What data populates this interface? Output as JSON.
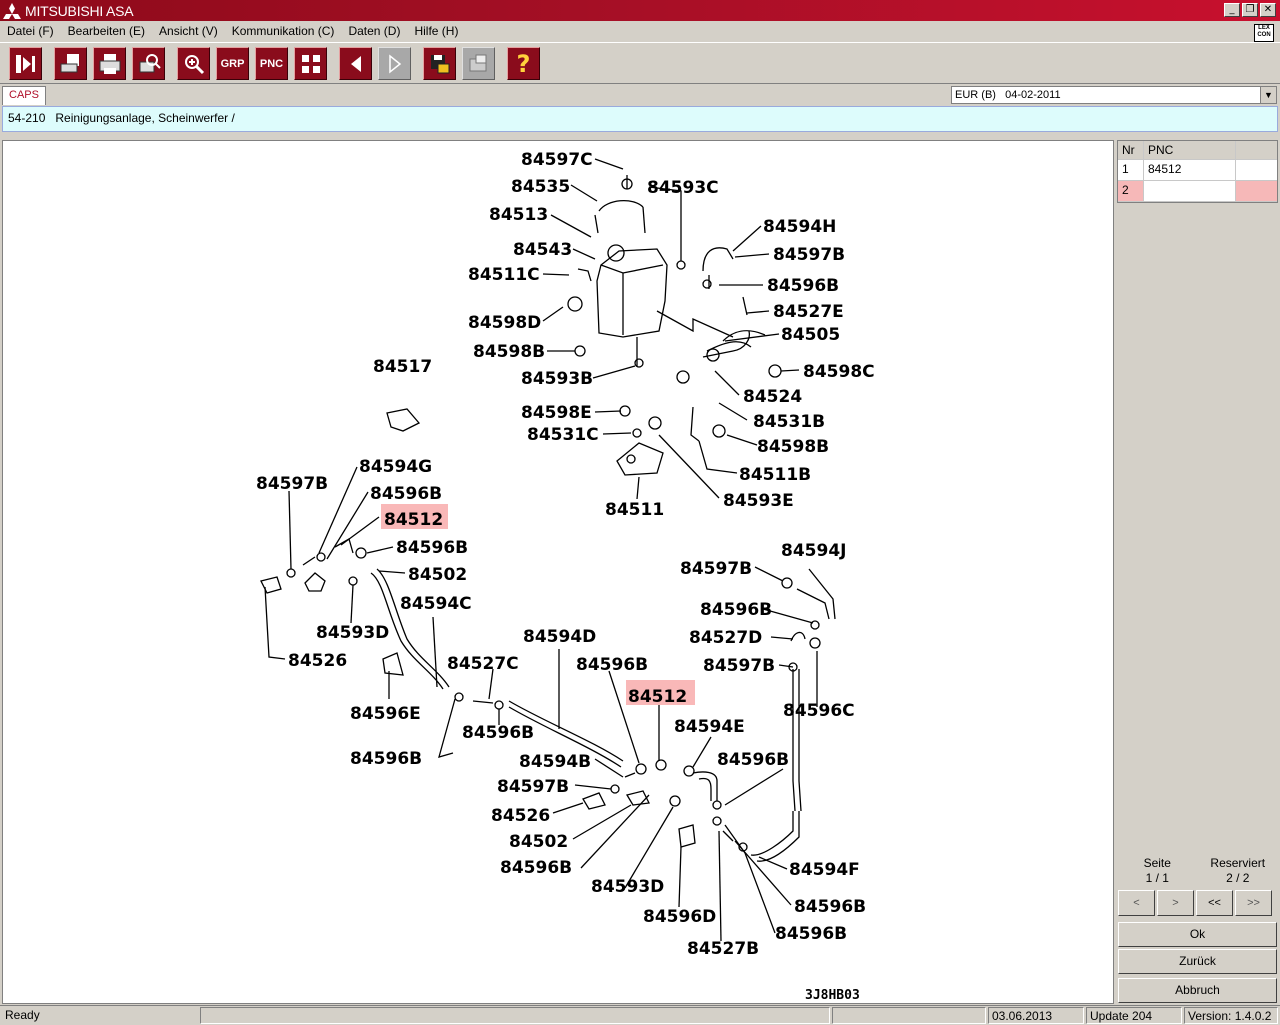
{
  "window": {
    "title": "MITSUBISHI ASA"
  },
  "menu": [
    "Datei (F)",
    "Bearbeiten (E)",
    "Ansicht (V)",
    "Kommunikation (C)",
    "Daten (D)",
    "Hilfe (H)"
  ],
  "lexcon": "LEX CON",
  "toolbar": {
    "grp": "GRP",
    "pnc": "PNC",
    "help": "?"
  },
  "tab": {
    "label": "CAPS"
  },
  "region_select": "EUR (B)   04-02-2011",
  "info": {
    "code": "54-210",
    "title": "Reinigungsanlage, Scheinwerfer /"
  },
  "drawing": {
    "id": "3J8HB03",
    "labels": [
      {
        "text": "84597C",
        "hl": false
      },
      {
        "text": "84535",
        "hl": false
      },
      {
        "text": "84593C",
        "hl": false
      },
      {
        "text": "84513",
        "hl": false
      },
      {
        "text": "84594H",
        "hl": false
      },
      {
        "text": "84543",
        "hl": false
      },
      {
        "text": "84597B",
        "hl": false
      },
      {
        "text": "84511C",
        "hl": false
      },
      {
        "text": "84596B",
        "hl": false
      },
      {
        "text": "84527E",
        "hl": false
      },
      {
        "text": "84598D",
        "hl": false
      },
      {
        "text": "84505",
        "hl": false
      },
      {
        "text": "84598B",
        "hl": false
      },
      {
        "text": "84517",
        "hl": false
      },
      {
        "text": "84598C",
        "hl": false
      },
      {
        "text": "84593B",
        "hl": false
      },
      {
        "text": "84524",
        "hl": false
      },
      {
        "text": "84598E",
        "hl": false
      },
      {
        "text": "84531B",
        "hl": false
      },
      {
        "text": "84531C",
        "hl": false
      },
      {
        "text": "84598B",
        "hl": false
      },
      {
        "text": "84594G",
        "hl": false
      },
      {
        "text": "84511B",
        "hl": false
      },
      {
        "text": "84597B",
        "hl": false
      },
      {
        "text": "84596B",
        "hl": false
      },
      {
        "text": "84593E",
        "hl": false
      },
      {
        "text": "84512",
        "hl": true
      },
      {
        "text": "84511",
        "hl": false
      },
      {
        "text": "84596B",
        "hl": false
      },
      {
        "text": "84594J",
        "hl": false
      },
      {
        "text": "84502",
        "hl": false
      },
      {
        "text": "84597B",
        "hl": false
      },
      {
        "text": "84594C",
        "hl": false
      },
      {
        "text": "84596B",
        "hl": false
      },
      {
        "text": "84593D",
        "hl": false
      },
      {
        "text": "84594D",
        "hl": false
      },
      {
        "text": "84527D",
        "hl": false
      },
      {
        "text": "84526",
        "hl": false
      },
      {
        "text": "84527C",
        "hl": false
      },
      {
        "text": "84596B",
        "hl": false
      },
      {
        "text": "84597B",
        "hl": false
      },
      {
        "text": "84512",
        "hl": true
      },
      {
        "text": "84596E",
        "hl": false
      },
      {
        "text": "84596C",
        "hl": false
      },
      {
        "text": "84596B",
        "hl": false
      },
      {
        "text": "84594E",
        "hl": false
      },
      {
        "text": "84596B",
        "hl": false
      },
      {
        "text": "84594B",
        "hl": false
      },
      {
        "text": "84596B",
        "hl": false
      },
      {
        "text": "84597B",
        "hl": false
      },
      {
        "text": "84526",
        "hl": false
      },
      {
        "text": "84502",
        "hl": false
      },
      {
        "text": "84594F",
        "hl": false
      },
      {
        "text": "84596B",
        "hl": false
      },
      {
        "text": "84593D",
        "hl": false
      },
      {
        "text": "84596B",
        "hl": false
      },
      {
        "text": "84596D",
        "hl": false
      },
      {
        "text": "84596B",
        "hl": false
      },
      {
        "text": "84527B",
        "hl": false
      }
    ]
  },
  "parts_table": {
    "headers": [
      "Nr",
      "PNC",
      ""
    ],
    "rows": [
      [
        "1",
        "84512",
        ""
      ],
      [
        "2",
        "",
        ""
      ]
    ]
  },
  "pager": {
    "seite_label": "Seite",
    "seite_value": "1 / 1",
    "reserviert_label": "Reserviert",
    "reserviert_value": "2 / 2"
  },
  "nav_buttons": [
    "<",
    ">",
    "<<",
    ">>"
  ],
  "buttons": {
    "ok": "Ok",
    "back": "Zurück",
    "cancel": "Abbruch"
  },
  "status": {
    "ready": "Ready",
    "date": "03.06.2013",
    "update": "Update 204",
    "version": "Version: 1.4.0.2"
  },
  "colors": {
    "title_bar": "#a40f25",
    "highlight": "#f9b8b8",
    "info_bar": "#ddfcfc"
  }
}
